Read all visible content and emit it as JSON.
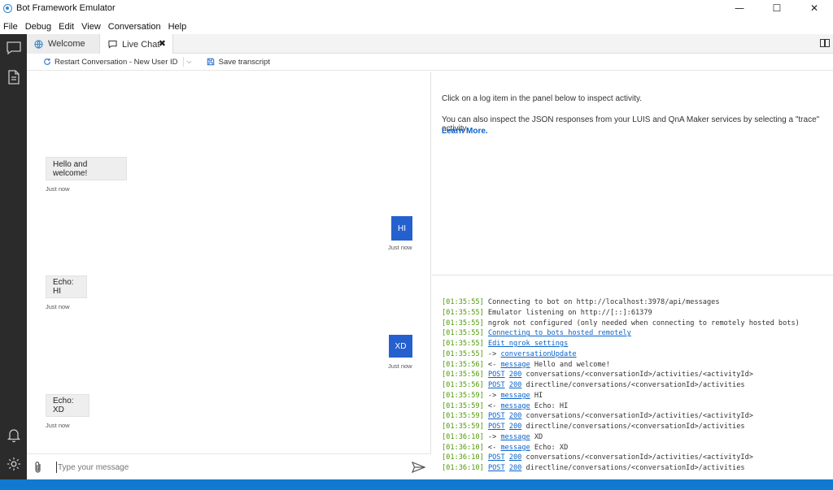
{
  "window": {
    "title": "Bot Framework Emulator",
    "minimize": "—",
    "maximize": "☐",
    "close": "✕"
  },
  "menu": [
    "File",
    "Debug",
    "Edit",
    "View",
    "Conversation",
    "Help"
  ],
  "tabs": {
    "welcome": "Welcome",
    "live_chat": "Live Chat",
    "close": "✖"
  },
  "toolbar": {
    "restart": "Restart Conversation - New User ID",
    "save": "Save transcript"
  },
  "chat": {
    "messages": [
      {
        "from": "bot",
        "text": "Hello and welcome!",
        "time": "Just now"
      },
      {
        "from": "user",
        "text": "HI",
        "time": "Just now"
      },
      {
        "from": "bot",
        "text": "Echo: HI",
        "time": "Just now"
      },
      {
        "from": "user",
        "text": "XD",
        "time": "Just now"
      },
      {
        "from": "bot",
        "text": "Echo: XD",
        "time": "Just now"
      }
    ],
    "input_placeholder": "Type your message"
  },
  "inspector": {
    "line1": "Click on a log item in the panel below to inspect activity.",
    "line2": "You can also inspect the JSON responses from your LUIS and QnA Maker services by selecting a \"trace\" activity.",
    "learn_more": "Learn More."
  },
  "log": [
    {
      "ts": "[01:35:55]",
      "parts": [
        {
          "t": " Connecting to bot on http://localhost:3978/api/messages"
        }
      ]
    },
    {
      "ts": "[01:35:55]",
      "parts": [
        {
          "t": " Emulator listening on http://[::]:61379"
        }
      ]
    },
    {
      "ts": "[01:35:55]",
      "parts": [
        {
          "t": " ngrok not configured (only needed when connecting to remotely hosted bots)"
        }
      ]
    },
    {
      "ts": "[01:35:55]",
      "parts": [
        {
          "t": " "
        },
        {
          "t": "Connecting to bots hosted remotely",
          "link": true
        }
      ]
    },
    {
      "ts": "[01:35:55]",
      "parts": [
        {
          "t": " "
        },
        {
          "t": "Edit ngrok settings",
          "link": true
        }
      ]
    },
    {
      "ts": "[01:35:55]",
      "parts": [
        {
          "t": " -> "
        },
        {
          "t": "conversationUpdate",
          "link": true
        }
      ]
    },
    {
      "ts": "[01:35:56]",
      "parts": [
        {
          "t": " <- "
        },
        {
          "t": "message",
          "link": true
        },
        {
          "t": " Hello and welcome!"
        }
      ]
    },
    {
      "ts": "[01:35:56]",
      "parts": [
        {
          "t": " "
        },
        {
          "t": "POST",
          "link": true
        },
        {
          "t": " "
        },
        {
          "t": "200",
          "link": true
        },
        {
          "t": " conversations/<conversationId>/activities/<activityId>"
        }
      ]
    },
    {
      "ts": "[01:35:56]",
      "parts": [
        {
          "t": " "
        },
        {
          "t": "POST",
          "link": true
        },
        {
          "t": " "
        },
        {
          "t": "200",
          "link": true
        },
        {
          "t": " directline/conversations/<conversationId>/activities"
        }
      ]
    },
    {
      "ts": "[01:35:59]",
      "parts": [
        {
          "t": " -> "
        },
        {
          "t": "message",
          "link": true
        },
        {
          "t": " HI"
        }
      ]
    },
    {
      "ts": "[01:35:59]",
      "parts": [
        {
          "t": " <- "
        },
        {
          "t": "message",
          "link": true
        },
        {
          "t": " Echo: HI"
        }
      ]
    },
    {
      "ts": "[01:35:59]",
      "parts": [
        {
          "t": " "
        },
        {
          "t": "POST",
          "link": true
        },
        {
          "t": " "
        },
        {
          "t": "200",
          "link": true
        },
        {
          "t": " conversations/<conversationId>/activities/<activityId>"
        }
      ]
    },
    {
      "ts": "[01:35:59]",
      "parts": [
        {
          "t": " "
        },
        {
          "t": "POST",
          "link": true
        },
        {
          "t": " "
        },
        {
          "t": "200",
          "link": true
        },
        {
          "t": " directline/conversations/<conversationId>/activities"
        }
      ]
    },
    {
      "ts": "[01:36:10]",
      "parts": [
        {
          "t": " -> "
        },
        {
          "t": "message",
          "link": true
        },
        {
          "t": " XD"
        }
      ]
    },
    {
      "ts": "[01:36:10]",
      "parts": [
        {
          "t": " <- "
        },
        {
          "t": "message",
          "link": true
        },
        {
          "t": " Echo: XD"
        }
      ]
    },
    {
      "ts": "[01:36:10]",
      "parts": [
        {
          "t": " "
        },
        {
          "t": "POST",
          "link": true
        },
        {
          "t": " "
        },
        {
          "t": "200",
          "link": true
        },
        {
          "t": " conversations/<conversationId>/activities/<activityId>"
        }
      ]
    },
    {
      "ts": "[01:36:10]",
      "parts": [
        {
          "t": " "
        },
        {
          "t": "POST",
          "link": true
        },
        {
          "t": " "
        },
        {
          "t": "200",
          "link": true
        },
        {
          "t": " directline/conversations/<conversationId>/activities"
        }
      ]
    }
  ],
  "colors": {
    "accent": "#0f7acf",
    "user_bubble": "#2560cf",
    "timestamp": "#4e9a06",
    "link": "#0a63c9"
  },
  "icons": {
    "sidebar": [
      "chat-icon",
      "document-icon",
      "bell-icon",
      "gear-icon"
    ],
    "composer": [
      "paperclip-icon",
      "send-icon"
    ]
  }
}
